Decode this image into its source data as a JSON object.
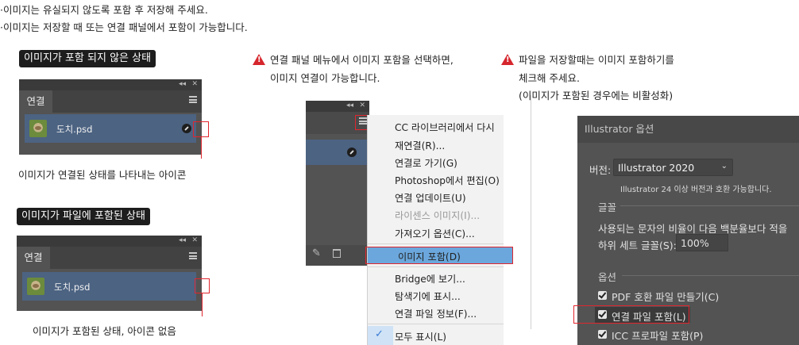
{
  "intro": {
    "line1": "·이미지는 유실되지 않도록 포함 후 저장해 주세요.",
    "line2": "·이미지는 저장할 때  또는 연결 패널에서 포함이 가능합니다."
  },
  "sectionA": {
    "label": "이미지가 포함 되지 않은 상태",
    "panel": {
      "collapse": "◂◂",
      "close": "✕",
      "tab": "연결",
      "filename": "도치.psd"
    },
    "caption": "이미지가 연결된 상태를 나타내는 아이콘"
  },
  "sectionB": {
    "label": "이미지가 파일에 포함된 상태",
    "panel": {
      "collapse": "◂◂",
      "close": "✕",
      "tab": "연결",
      "filename": "도치.psd"
    },
    "caption": "이미지가 포함된 상태, 아이콘 없음"
  },
  "middle": {
    "note_line1": "연결 패널 메뉴에서 이미지 포함을 선택하면,",
    "note_line2": "이미지 연결이 가능합니다.",
    "panel": {
      "collapse": "◂◂",
      "close": "✕"
    },
    "menu": [
      {
        "label": "CC 라이브러리에서 다시",
        "dim": false
      },
      {
        "label": "재연결(R)...",
        "dim": false
      },
      {
        "label": "연결로 가기(G)",
        "dim": false
      },
      {
        "label": "Photoshop에서 편집(O)",
        "dim": false
      },
      {
        "label": "연결 업데이트(U)",
        "dim": false
      },
      {
        "label": "라이센스 이미지(I)...",
        "dim": true
      },
      {
        "label": "가져오기 옵션(C)...",
        "dim": false
      },
      {
        "label": "이미지 포함(D)",
        "dim": false,
        "highlight": true
      },
      {
        "label": "Bridge에 보기...",
        "dim": false
      },
      {
        "label": "탐색기에 표시...",
        "dim": false
      },
      {
        "label": "연결 파일 정보(F)...",
        "dim": false
      },
      {
        "label": "모두 표시(L)",
        "dim": false,
        "checked": true
      }
    ],
    "check_mark": "✓"
  },
  "right": {
    "note_line1": "파일을 저장할때는 이미지 포함하기를",
    "note_line2": "체크해 주세요.",
    "note_line3": "(이미지가 포함된 경우에는 비활성화)",
    "dialog": {
      "title": "Illustrator 옵션",
      "version_label": "버전:",
      "version_value": "Illustrator 2020",
      "version_note": "Illustrator 24 이상 버전과 호환 가능합니다.",
      "fonts_group": "글꼴",
      "fonts_text": "사용되는 문자의 비율이 다음 백분율보다 적을",
      "subset_label": "하위 세트 글꼴(S):",
      "subset_value": "100%",
      "options_group": "옵션",
      "opt1": "PDF 호환 파일 만들기(C)",
      "opt2": "연결 파일 포함(L)",
      "opt3": "ICC 프로파일 포함(P)"
    }
  },
  "colors": {
    "accent_red": "#e0262e",
    "menu_highlight": "#6ba7dc",
    "panel_bg": "#535353",
    "link_row": "#4c6382"
  }
}
